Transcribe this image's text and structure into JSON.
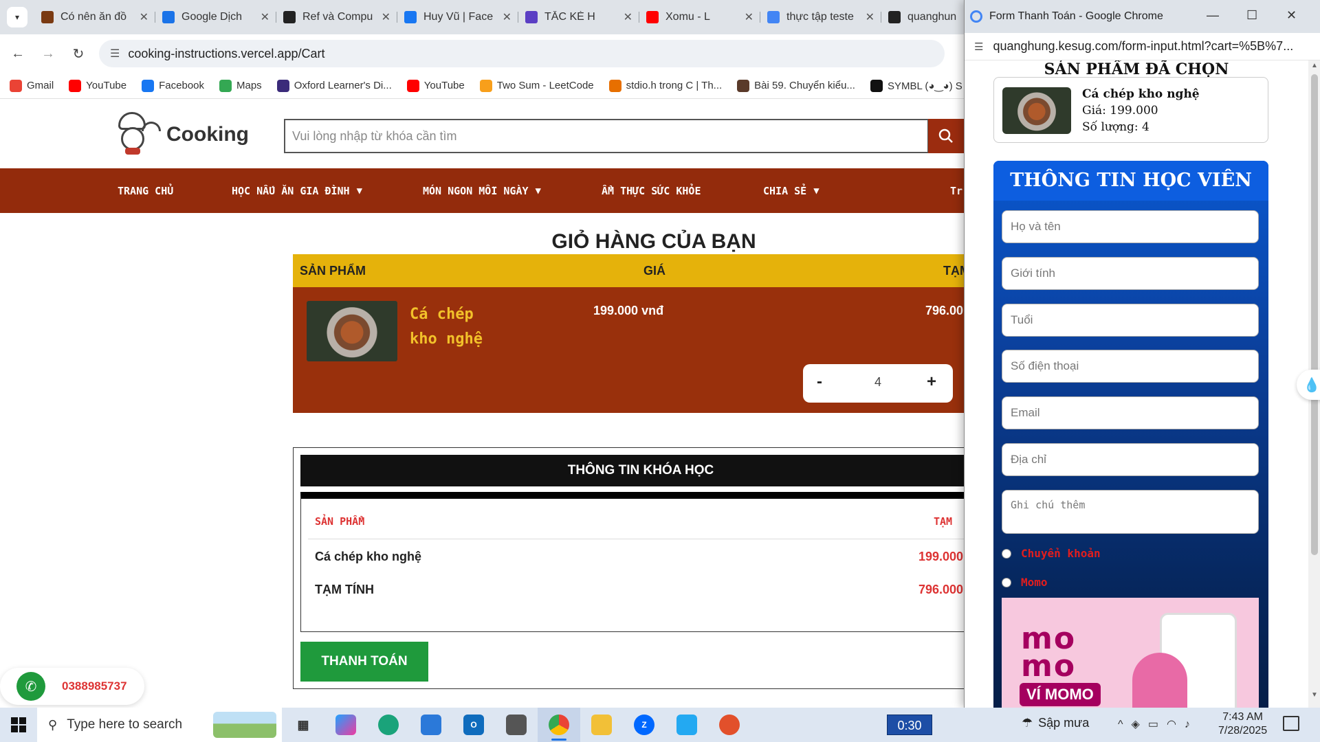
{
  "browser": {
    "tabs": [
      {
        "title": "Có nên ăn đồ",
        "color": "#7a3a12"
      },
      {
        "title": "Google Dịch",
        "color": "#1a73e8"
      },
      {
        "title": "Ref và Compu",
        "color": "#222222"
      },
      {
        "title": "Huy Vũ | Face",
        "color": "#1877f2"
      },
      {
        "title": "TẮC KÈ H",
        "color": "#5b3fc4"
      },
      {
        "title": "Xomu - L",
        "color": "#ff0000"
      },
      {
        "title": "thực tập teste",
        "color": "#4285f4"
      },
      {
        "title": "quanghun",
        "color": "#222222"
      }
    ],
    "url": "cooking-instructions.vercel.app/Cart",
    "bookmarks": [
      {
        "label": "Gmail",
        "color": "#ea4335"
      },
      {
        "label": "YouTube",
        "color": "#ff0000"
      },
      {
        "label": "Facebook",
        "color": "#1877f2"
      },
      {
        "label": "Maps",
        "color": "#34a853"
      },
      {
        "label": "Oxford Learner's Di...",
        "color": "#3b2b7a"
      },
      {
        "label": "YouTube",
        "color": "#ff0000"
      },
      {
        "label": "Two Sum - LeetCode",
        "color": "#f89f1b"
      },
      {
        "label": "stdio.h trong C | Th...",
        "color": "#e76f00"
      },
      {
        "label": "Bài 59. Chuyển kiểu...",
        "color": "#5a3a2a"
      },
      {
        "label": "SYMBL (◕‿◕) S",
        "color": "#111111"
      }
    ]
  },
  "site": {
    "brand": "Cooking",
    "search_placeholder": "Vui lòng nhập từ khóa cần tìm",
    "nav": [
      {
        "label": "TRANG CHỦ",
        "caret": ""
      },
      {
        "label": "HỌC NẤU ĂN GIA ĐÌNH",
        "caret": "▼"
      },
      {
        "label": "MÓN NGON MỖI NGÀY",
        "caret": "▼"
      },
      {
        "label": "ẨM THỰC SỨC KHỎE",
        "caret": ""
      },
      {
        "label": "CHIA SẺ",
        "caret": "▼"
      },
      {
        "label": "Tr",
        "caret": ""
      }
    ],
    "cart": {
      "title": "GIỎ HÀNG CỦA BẠN",
      "col_product": "SẢN PHẨM",
      "col_price": "GIÁ",
      "col_subtotal": "TẠM",
      "item_name": "Cá chép kho nghệ",
      "item_price": "199.000 vnđ",
      "item_subtotal": "796.00",
      "qty_minus": "-",
      "qty_value": "4",
      "qty_plus": "+"
    },
    "course": {
      "bar_title": "THÔNG TIN KHÓA HỌC",
      "col_product": "SẢN PHẨM",
      "col_subtotal": "TẠM",
      "item_name": "Cá chép kho nghệ",
      "item_price": "199.000",
      "total_label": "TẠM TÍNH",
      "total_value": "796.000",
      "pay_button": "THANH TOÁN"
    },
    "hotline": "0388985737"
  },
  "popup": {
    "window_title": "Form Thanh Toán - Google Chrome",
    "url": "quanghung.kesug.com/form-input.html?cart=%5B%7...",
    "selected_title": "SẢN PHẨM ĐÃ CHỌN",
    "item_name": "Cá chép kho nghệ",
    "item_price": "Giá: 199.000",
    "item_qty": "Số lượng: 4",
    "form_title": "THÔNG TIN HỌC VIÊN",
    "fields": {
      "name": "Họ và tên",
      "gender": "Giới tính",
      "age": "Tuổi",
      "phone": "Số điện thoại",
      "email": "Email",
      "address": "Địa chỉ",
      "note": "Ghi chú thêm"
    },
    "pay_transfer": "Chuyển khoản",
    "pay_momo": "Momo",
    "momo_banner": {
      "logo_line1": "mo",
      "logo_line2": "mo",
      "caption": "VÍ MOMO"
    }
  },
  "taskbar": {
    "search_placeholder": "Type here to search",
    "timer": "0:30",
    "weather": "Sập mưa",
    "time": "7:43 AM",
    "date": "7/28/2025",
    "apps": [
      "task-view",
      "copilot",
      "edge",
      "store",
      "outlook",
      "files-app",
      "chrome",
      "file-explorer",
      "zalo",
      "vscode",
      "snipping-tool"
    ]
  },
  "colors": {
    "nav_bg": "#932b0c",
    "cart_head": "#e5b20b",
    "cart_row": "#99300c",
    "accent_green": "#1f9a3c",
    "form_blue": "#0d5ee0"
  }
}
